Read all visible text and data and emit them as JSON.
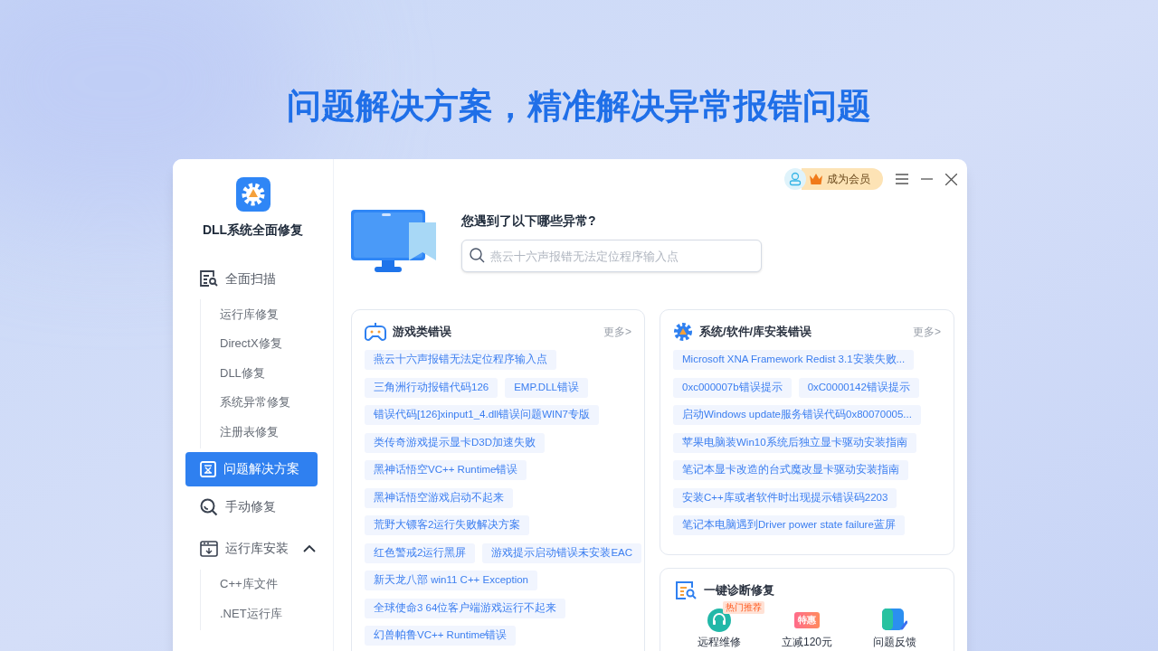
{
  "headline": "问题解决方案，精准解决异常报错问题",
  "app": {
    "name": "DLL系统全面修复"
  },
  "nav": [
    {
      "label": "全面扫描",
      "selected": false,
      "children": [
        {
          "label": "运行库修复",
          "selected": false
        },
        {
          "label": "DirectX修复",
          "selected": false
        },
        {
          "label": "DLL修复",
          "selected": false
        },
        {
          "label": "系统异常修复",
          "selected": false
        },
        {
          "label": "注册表修复",
          "selected": false
        }
      ]
    },
    {
      "label": "问题解决方案",
      "selected": true
    },
    {
      "label": "手动修复",
      "selected": false
    },
    {
      "label": "运行库安装",
      "selected": false,
      "expanded": true,
      "children": [
        {
          "label": "C++库文件",
          "selected": false
        },
        {
          "label": ".NET运行库",
          "selected": false
        }
      ]
    }
  ],
  "header": {
    "member_button": "成为会员"
  },
  "question": "您遇到了以下哪些异常?",
  "search": {
    "placeholder": "燕云十六声报错无法定位程序输入点"
  },
  "cards": [
    {
      "title": "游戏类错误",
      "more": "更多>",
      "tag_rows": [
        [
          "燕云十六声报错无法定位程序输入点"
        ],
        [
          "三角洲行动报错代码126",
          "EMP.DLL错误"
        ],
        [
          "错误代码[126]xinput1_4.dll错误问题WIN7专版"
        ],
        [
          "类传奇游戏提示显卡D3D加速失败"
        ],
        [
          "黑神话悟空VC++ Runtime错误"
        ],
        [
          "黑神话悟空游戏启动不起来"
        ],
        [
          "荒野大镖客2运行失败解决方案"
        ],
        [
          "红色警戒2运行黑屏",
          "游戏提示启动错误未安装EAC"
        ],
        [
          "新天龙八部 win11 C++ Exception"
        ],
        [
          "全球使命3 64位客户端游戏运行不起来"
        ],
        [
          "幻兽帕鲁VC++ Runtime错误"
        ]
      ]
    },
    {
      "title": "系统/软件/库安装错误",
      "more": "更多>",
      "tag_rows": [
        [
          "Microsoft XNA Framework Redist 3.1安装失败..."
        ],
        [
          "0xc000007b错误提示",
          "0xC0000142错误提示"
        ],
        [
          "启动Windows update服务错误代码0x80070005..."
        ],
        [
          "苹果电脑装Win10系统后独立显卡驱动安装指南"
        ],
        [
          "笔记本显卡改造的台式魔改显卡驱动安装指南"
        ],
        [
          "安装C++库或者软件时出现提示错误码2203"
        ],
        [
          "笔记本电脑遇到Driver power state failure蓝屏"
        ]
      ]
    }
  ],
  "diagnose": {
    "title": "一键诊断修复",
    "tools": [
      {
        "label": "远程维修",
        "badge": "热门推荐"
      },
      {
        "label": "立减120元",
        "icon_text": "特惠"
      },
      {
        "label": "问题反馈"
      }
    ]
  }
}
